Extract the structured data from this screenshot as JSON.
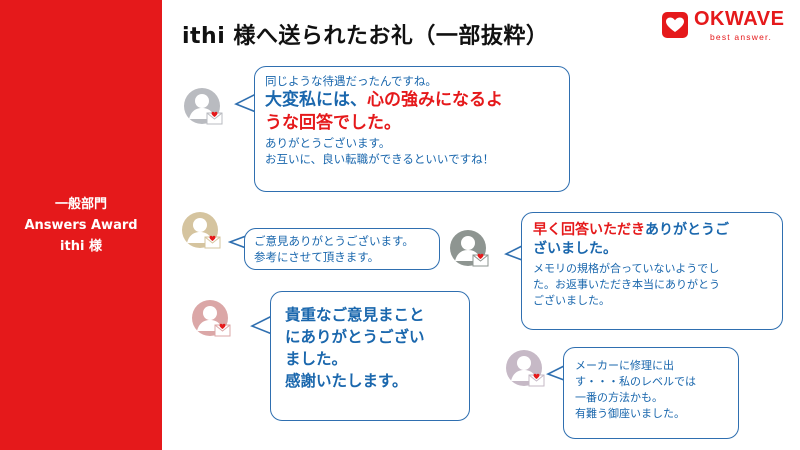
{
  "sidebar": {
    "line1": "一般部門",
    "line2": "Answers Award",
    "line3": "ithi 様"
  },
  "title": "ithi 様へ送られたお礼（一部抜粋）",
  "logo": {
    "word": "OKWAVE",
    "tagline": "best answer.",
    "brand_color": "#e5191b"
  },
  "messages": [
    {
      "line1": "同じような待遇だったんですね。",
      "big1_a": "大変私には、",
      "big1_b": "心の強みになるよ",
      "big2": "うな回答でした。",
      "line4": "ありがとうございます。",
      "line5": "お互いに、良い転職ができるといいですね！"
    },
    {
      "line1": "ご意見ありがとうございます。",
      "line2": "参考にさせて頂きます。"
    },
    {
      "big1_a": "早く回答いただき",
      "big1_b": "ありがとうご",
      "big2": "ざいました。",
      "line3": "メモリの規格が合っていないようでし",
      "line4": "た。お返事いただき本当にありがとう",
      "line5": "ございました。"
    },
    {
      "line1": "貴重なご意見まこと",
      "line2": "にありがとうござい",
      "line3": "ました。",
      "line4": "感謝いたします。"
    },
    {
      "line1": "メーカーに修理に出",
      "line2": "す・・・私のレベルでは",
      "line3": "一番の方法かも。",
      "line4": "有難う御座いました。"
    }
  ],
  "icons": {
    "avatar": "user-avatar-icon",
    "mail": "heart-mail-icon",
    "logo": "heart-logo-icon"
  },
  "colors": {
    "accent_red": "#e5191b",
    "text_blue": "#1a67ad",
    "bubble_border": "#2f6fb0"
  }
}
